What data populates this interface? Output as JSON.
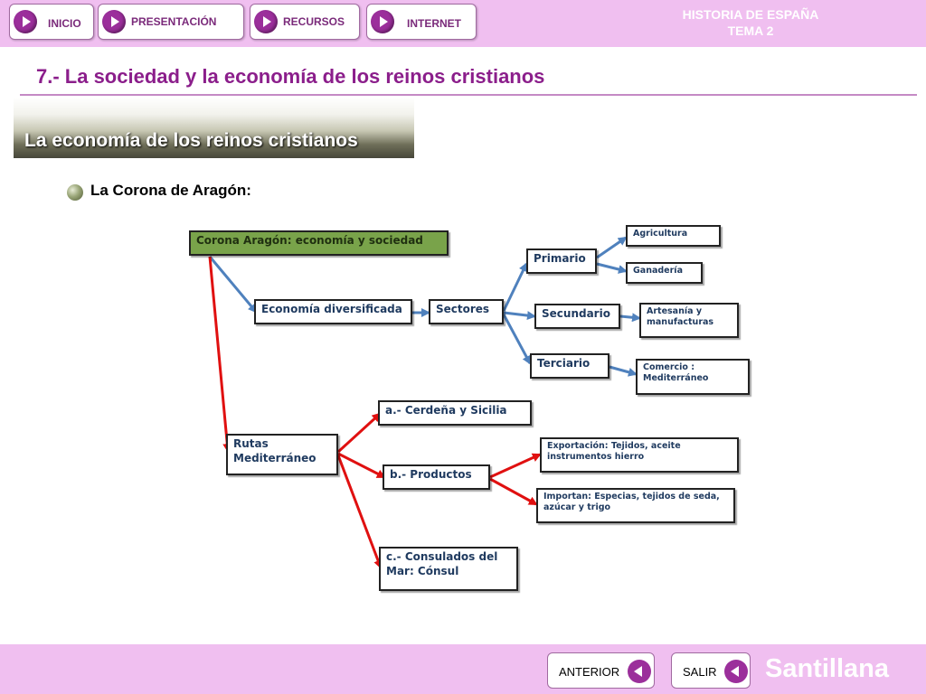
{
  "nav": {
    "inicio": "INICIO",
    "presentacion": "PRESENTACIÓN",
    "recursos": "RECURSOS",
    "internet": "INTERNET"
  },
  "brand": {
    "line1": "HISTORIA DE ESPAÑA",
    "line2": "TEMA 2"
  },
  "title": "7.- La sociedad y la economía de los reinos cristianos",
  "section_banner": "La economía de los reinos cristianos",
  "subheading": "La Corona de Aragón:",
  "diagram": {
    "root": "Corona Aragón: economía y sociedad",
    "economia": "Economía diversificada",
    "sectores": "Sectores",
    "primario": "Primario",
    "agricultura": "Agricultura",
    "ganaderia": "Ganadería",
    "secundario": "Secundario",
    "artesania": "Artesanía y manufacturas",
    "terciario": "Terciario",
    "comercio": "Comercio : Mediterráneo",
    "rutas": "Rutas Mediterráneo",
    "cerdena": "a.- Cerdeña y Sicilia",
    "productos": "b.- Productos",
    "exportacion": "Exportación: Tejidos, aceite instrumentos hierro",
    "importan": "Importan: Especias, tejidos de seda, azúcar y trigo",
    "consulados": "c.- Consulados del Mar: Cónsul"
  },
  "footer": {
    "anterior": "ANTERIOR",
    "salir": "SALIR",
    "logo": "Santillana"
  },
  "colors": {
    "header_bg": "#f0bff0",
    "accent_purple": "#9b2f9b",
    "title_color": "#8b1e8b",
    "blue_arrow": "#4f81bd",
    "red_arrow": "#e01010",
    "root_node": "#79a34a"
  }
}
